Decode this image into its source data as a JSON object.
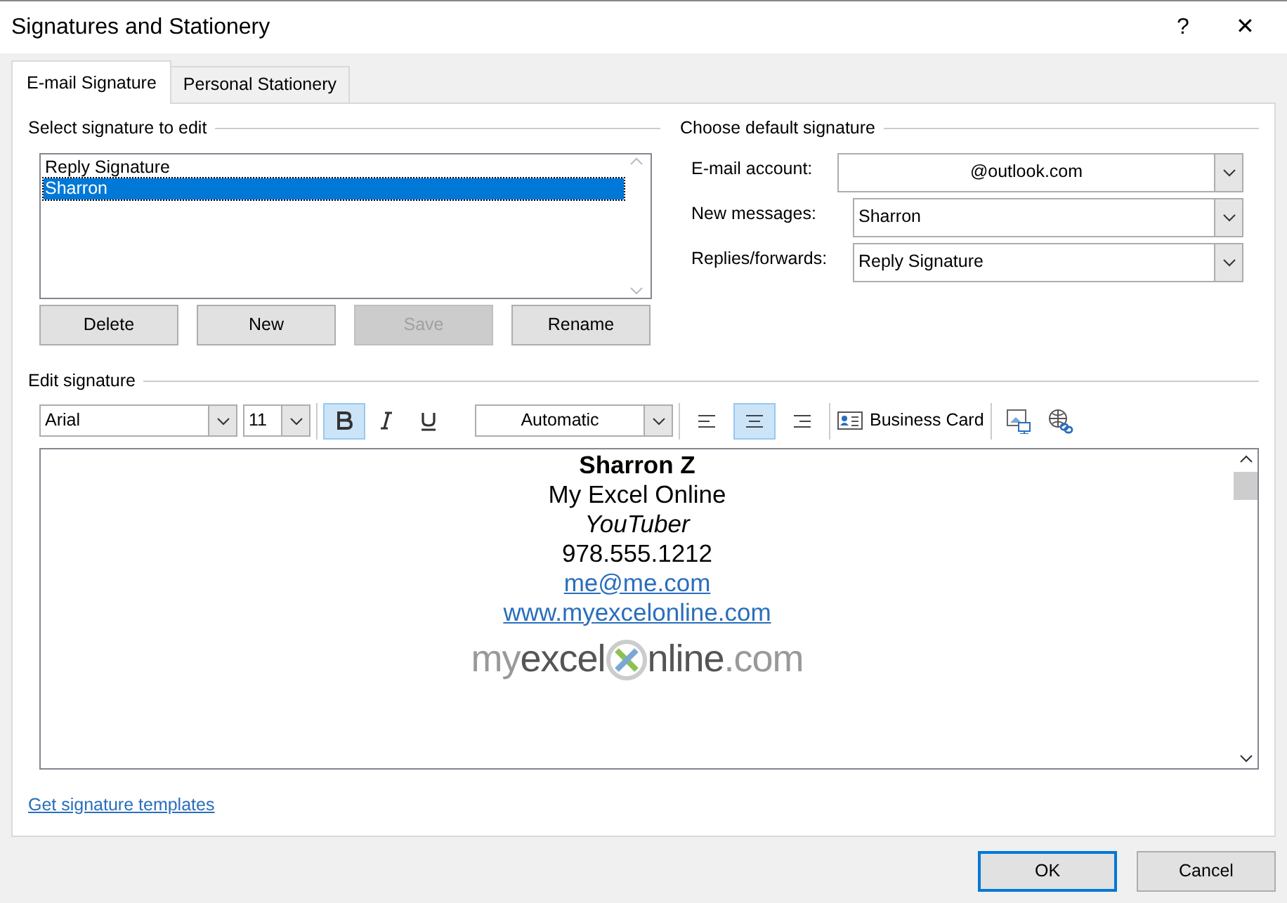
{
  "window": {
    "title": "Signatures and Stationery",
    "help": "?",
    "close": "✕"
  },
  "tabs": [
    {
      "label": "E-mail Signature",
      "selected": true
    },
    {
      "label": "Personal Stationery",
      "selected": false
    }
  ],
  "select_signature": {
    "heading": "Select signature to edit",
    "items": [
      {
        "label": "Reply Signature",
        "selected": false
      },
      {
        "label": "Sharron",
        "selected": true
      }
    ],
    "buttons": [
      {
        "label": "Delete",
        "disabled": false
      },
      {
        "label": "New",
        "disabled": false
      },
      {
        "label": "Save",
        "disabled": true
      },
      {
        "label": "Rename",
        "disabled": false
      }
    ]
  },
  "default_signature": {
    "heading": "Choose default signature",
    "fields": [
      {
        "label": "E-mail account:",
        "value": "@outlook.com",
        "centered": true
      },
      {
        "label": "New messages:",
        "value": "Sharron",
        "centered": false
      },
      {
        "label": "Replies/forwards:",
        "value": "Reply Signature",
        "centered": false
      }
    ]
  },
  "edit_signature": {
    "heading": "Edit signature",
    "toolbar": {
      "font": "Arial",
      "size": "11",
      "bold": true,
      "italic": false,
      "underline": false,
      "color_option": "Automatic",
      "align": [
        {
          "kind": "left",
          "selected": false
        },
        {
          "kind": "center",
          "selected": true
        },
        {
          "kind": "right",
          "selected": false
        }
      ],
      "business_card": "Business Card"
    },
    "lines": [
      {
        "kind": "bold",
        "text": "Sharron Z"
      },
      {
        "kind": "plain",
        "text": "My Excel Online"
      },
      {
        "kind": "italic",
        "text": "YouTuber"
      },
      {
        "kind": "plain",
        "text": "978.555.1212"
      },
      {
        "kind": "link",
        "text": "me@me.com"
      },
      {
        "kind": "link",
        "text": "www.myexcelonline.com"
      }
    ],
    "logo": {
      "part_1": "my",
      "part_2": "excel",
      "part_3": "nline",
      "part_4": ".com"
    }
  },
  "templates_link": "Get signature templates",
  "dialog_buttons": [
    {
      "label": "OK",
      "default": true
    },
    {
      "label": "Cancel",
      "default": false
    }
  ]
}
